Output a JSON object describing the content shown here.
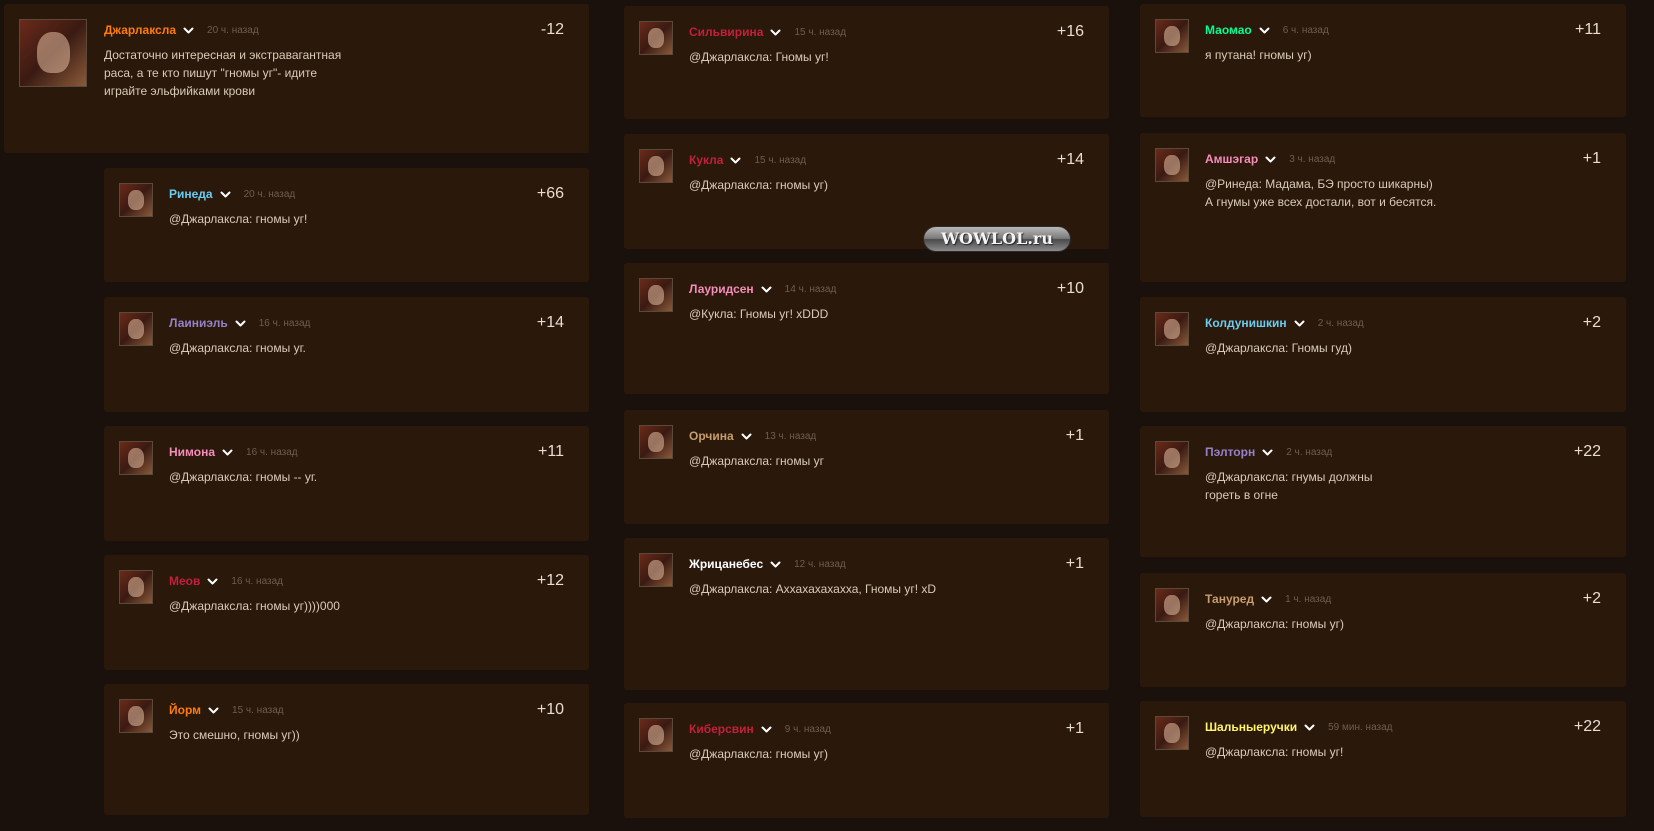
{
  "colors": {
    "background": "#1a100c",
    "card": "#2a180b",
    "text": "#d9cbb8",
    "timestamp": "#6f5d4c",
    "score": "#e8ddd0"
  },
  "comments": [
    {
      "author": "Джарлаксла",
      "name_color": "#ff7c0a",
      "time": "20 ч. назад",
      "score": "-12",
      "text": "Достаточно интересная и экстравагантная\nраса, а те кто пишут \"гномы уг\"- идите\nиграйте эльфийками крови"
    },
    {
      "author": "Ринеда",
      "name_color": "#69ccf0",
      "time": "20 ч. назад",
      "score": "+66",
      "text": "@Джарлаксла: гномы уг!"
    },
    {
      "author": "Лаиниэль",
      "name_color": "#9482c9",
      "time": "16 ч. назад",
      "score": "+14",
      "text": "@Джарлаксла: гномы уг."
    },
    {
      "author": "Нимона",
      "name_color": "#f58cba",
      "time": "16 ч. назад",
      "score": "+11",
      "text": "@Джарлаксла: гномы -- уг."
    },
    {
      "author": "Меов",
      "name_color": "#c41f3b",
      "time": "16 ч. назад",
      "score": "+12",
      "text": "@Джарлаксла: гномы уг))))000"
    },
    {
      "author": "Йорм",
      "name_color": "#ff7c0a",
      "time": "15 ч. назад",
      "score": "+10",
      "text": "Это смешно, гномы уг))"
    },
    {
      "author": "Сильвирина",
      "name_color": "#c41f3b",
      "time": "15 ч. назад",
      "score": "+16",
      "text": "@Джарлаксла: Гномы уг!"
    },
    {
      "author": "Кукла",
      "name_color": "#c41f3b",
      "time": "15 ч. назад",
      "score": "+14",
      "text": "@Джарлаксла: гномы уг)"
    },
    {
      "author": "Лауридсен",
      "name_color": "#f58cba",
      "time": "14 ч. назад",
      "score": "+10",
      "text": "@Кукла: Гномы уг!  xDDD"
    },
    {
      "author": "Орчина",
      "name_color": "#c79c6e",
      "time": "13 ч. назад",
      "score": "+1",
      "text": "@Джарлаксла: гномы уг"
    },
    {
      "author": "Жрицанебес",
      "name_color": "#ffffff",
      "time": "12 ч. назад",
      "score": "+1",
      "text": "@Джарлаксла: Аххахахахахха, Гномы уг!  xD"
    },
    {
      "author": "Киберсвин",
      "name_color": "#c41f3b",
      "time": "9 ч. назад",
      "score": "+1",
      "text": "@Джарлаксла: гномы уг)"
    },
    {
      "author": "Маомао",
      "name_color": "#00ff96",
      "time": "6 ч. назад",
      "score": "+11",
      "text": "я  путана!  гномы уг)"
    },
    {
      "author": "Амшэгар",
      "name_color": "#f58cba",
      "time": "3 ч. назад",
      "score": "+1",
      "text": "@Ринеда: Мадама, БЭ просто шикарны)\nА гнумы уже всех достали, вот и бесятся."
    },
    {
      "author": "Колдунишкин",
      "name_color": "#69ccf0",
      "time": "2 ч. назад",
      "score": "+2",
      "text": "@Джарлаксла: Гномы гуд)"
    },
    {
      "author": "Пэлторн",
      "name_color": "#9482c9",
      "time": "2 ч. назад",
      "score": "+22",
      "text": "@Джарлаксла: гнумы должны\nгореть в огне"
    },
    {
      "author": "Тануред",
      "name_color": "#c79c6e",
      "time": "1 ч. назад",
      "score": "+2",
      "text": "@Джарлаксла: гномы уг)"
    },
    {
      "author": "Шальныеручки",
      "name_color": "#fff569",
      "time": "59 мин. назад",
      "score": "+22",
      "text": "@Джарлаксла: гномы уг!"
    }
  ],
  "watermark": {
    "text": "WOWLOL.ru"
  }
}
